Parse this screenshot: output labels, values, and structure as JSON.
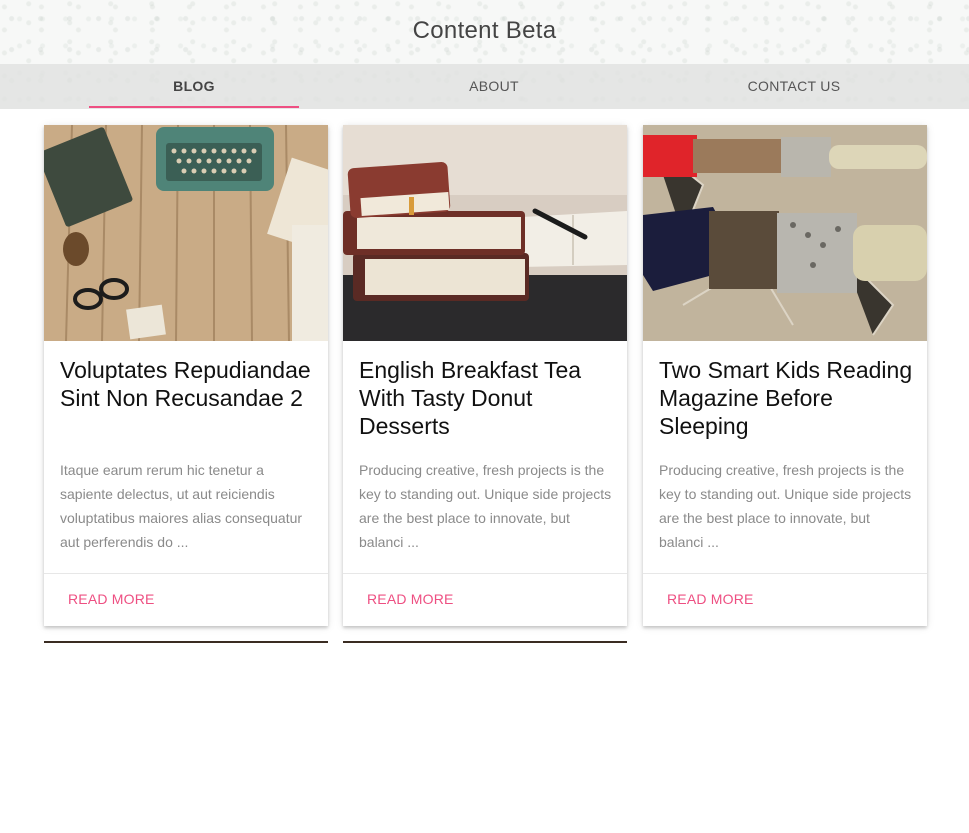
{
  "site": {
    "title": "Content Beta"
  },
  "nav": {
    "items": [
      {
        "label": "BLOG",
        "active": true
      },
      {
        "label": "ABOUT",
        "active": false
      },
      {
        "label": "CONTACT US",
        "active": false
      }
    ],
    "accent_color": "#ee4f82"
  },
  "posts": [
    {
      "title": "Voluptates Repudiandae Sint Non Recusandae 2",
      "excerpt": "Itaque earum rerum hic tenetur a sapiente delectus, ut aut reiciendis voluptatibus maiores alias consequatur aut perferendis do ...",
      "action": "READ MORE"
    },
    {
      "title": "English Breakfast Tea With Tasty Donut Desserts",
      "excerpt": "Producing creative, fresh projects is the key to standing out. Unique side projects are the best place to innovate, but balanci ...",
      "action": "READ MORE"
    },
    {
      "title": "Two Smart Kids Reading Magazine Before Sleeping",
      "excerpt": "Producing creative, fresh projects is the key to standing out. Unique side projects are the best place to innovate, but balanci ...",
      "action": "READ MORE"
    }
  ]
}
